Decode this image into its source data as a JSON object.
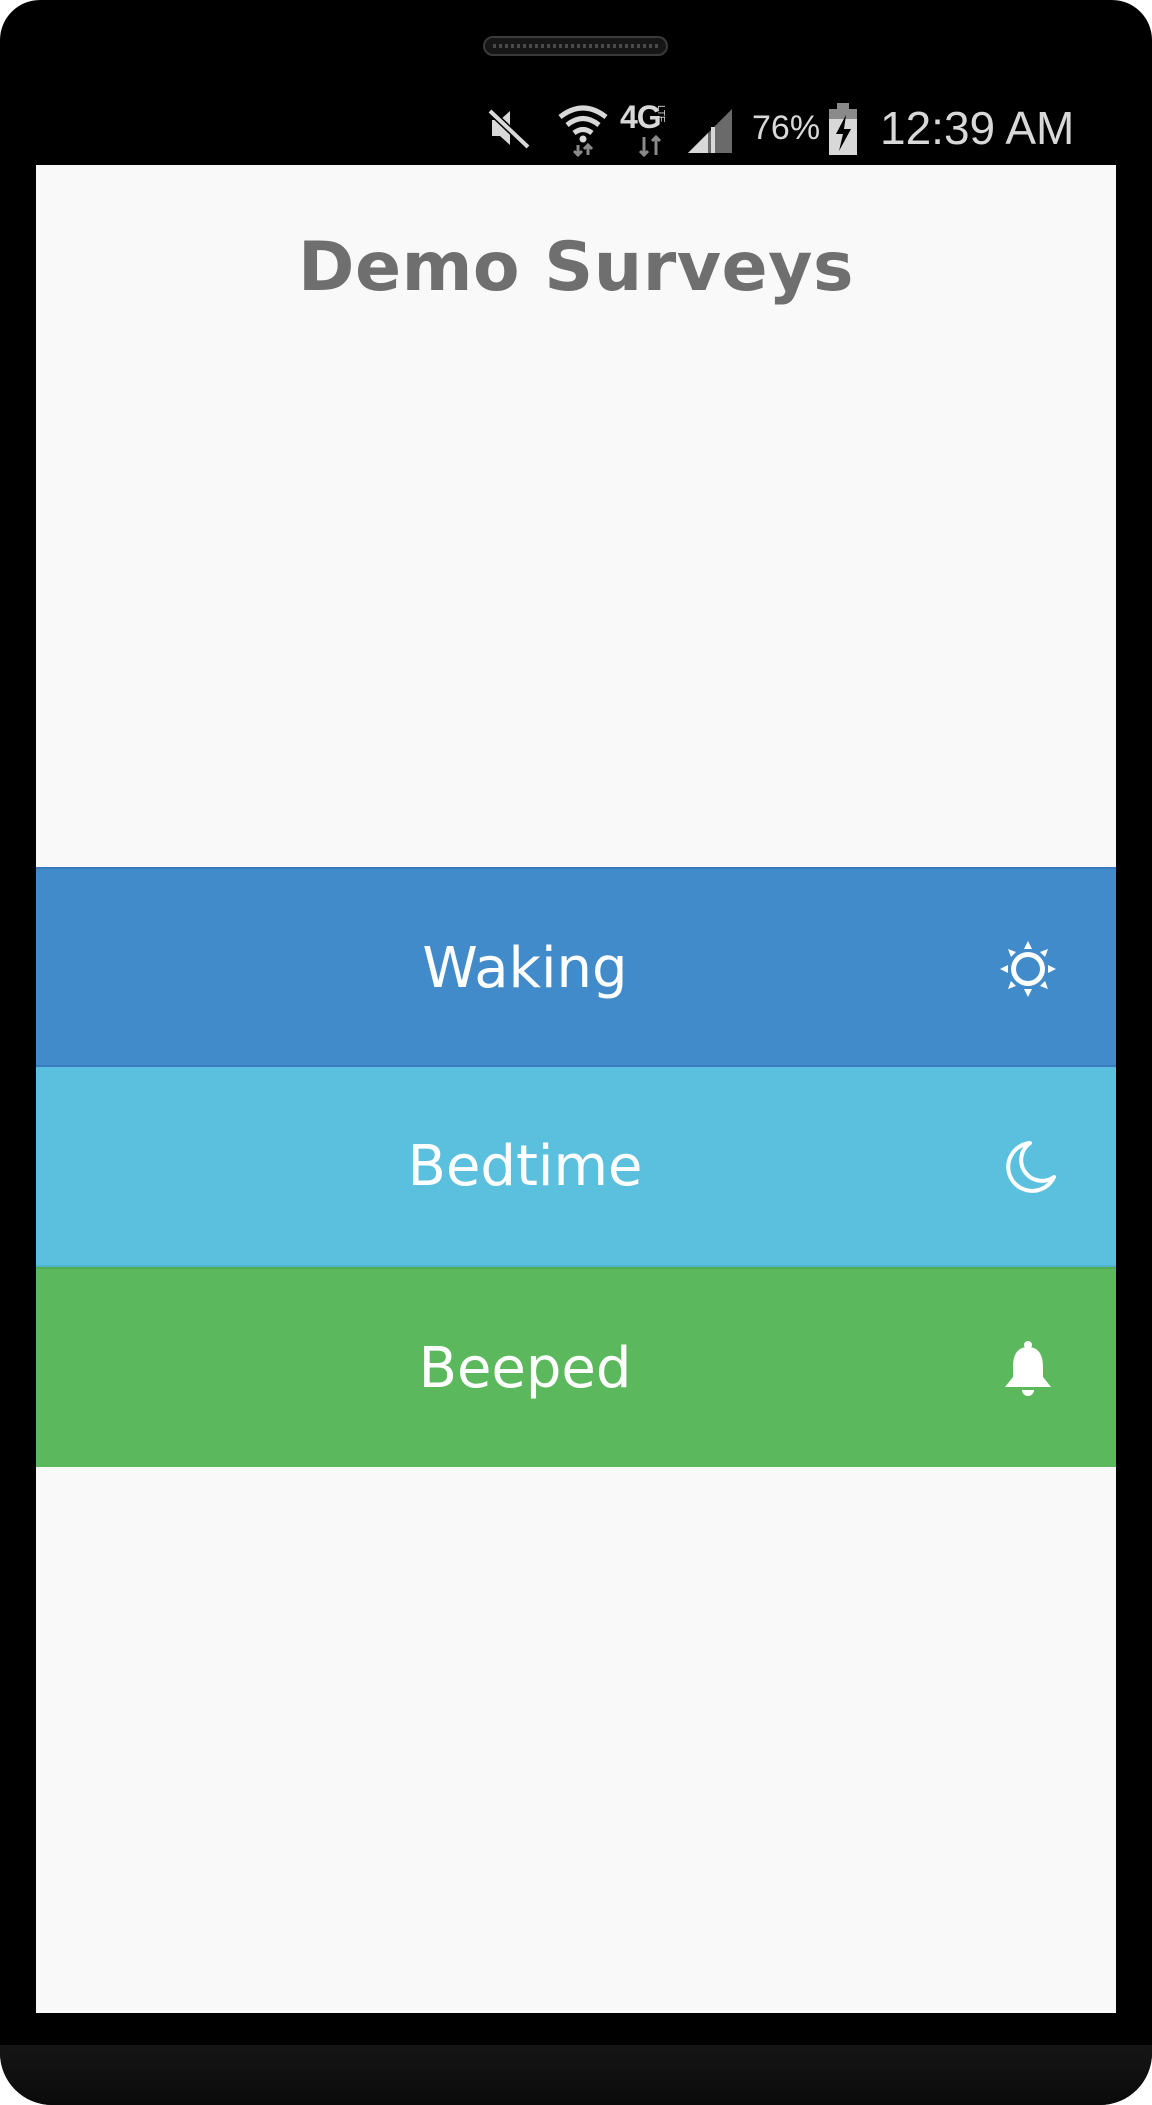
{
  "status_bar": {
    "battery_percent": "76%",
    "time": "12:39 AM",
    "network_label": "4G",
    "network_sublabel": "LTE",
    "icons": [
      "vibrate-mute-icon",
      "wifi-icon",
      "4g-lte-icon",
      "signal-icon",
      "battery-charging-icon"
    ]
  },
  "page": {
    "title": "Demo Surveys"
  },
  "surveys": [
    {
      "label": "Waking",
      "icon": "sun-icon",
      "color": "#428bca"
    },
    {
      "label": "Bedtime",
      "icon": "moon-icon",
      "color": "#5bc0de"
    },
    {
      "label": "Beeped",
      "icon": "bell-icon",
      "color": "#5cb85c"
    }
  ],
  "colors": {
    "background": "#f9f9f9",
    "title": "#6f6f6f",
    "button_text": "#ffffff"
  }
}
